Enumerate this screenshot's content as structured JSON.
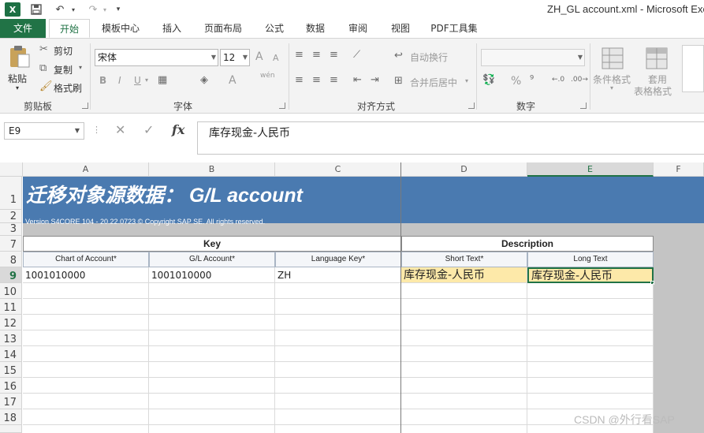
{
  "app": {
    "window_title": "ZH_GL account.xml - Microsoft Exc",
    "logo": "X"
  },
  "quick_access": {
    "save_icon": "save-icon",
    "undo_icon": "undo-icon",
    "redo_icon": "redo-icon",
    "customize_icon": "customize-icon"
  },
  "tabs": [
    {
      "label": "文件"
    },
    {
      "label": "开始"
    },
    {
      "label": "模板中心"
    },
    {
      "label": "插入"
    },
    {
      "label": "页面布局"
    },
    {
      "label": "公式"
    },
    {
      "label": "数据"
    },
    {
      "label": "审阅"
    },
    {
      "label": "视图"
    },
    {
      "label": "PDF工具集"
    }
  ],
  "ribbon": {
    "clipboard": {
      "paste": "粘贴",
      "cut": "剪切",
      "copy": "复制",
      "format_painter": "格式刷",
      "label": "剪贴板"
    },
    "font": {
      "name": "宋体",
      "size": "12",
      "bold": "B",
      "italic": "I",
      "underline": "U",
      "grow": "A",
      "shrink": "A",
      "font_color": "A",
      "phonetic": "wén",
      "label": "字体"
    },
    "alignment": {
      "wrap": "自动换行",
      "merge": "合并后居中",
      "label": "对齐方式"
    },
    "number": {
      "percent": "%",
      "label": "数字"
    },
    "styles": {
      "conditional": "条件格式",
      "table_format_1": "套用",
      "table_format_2": "表格格式"
    }
  },
  "formula_bar": {
    "name_box": "E9",
    "cancel": "✕",
    "enter": "✓",
    "fx": "fx",
    "formula": "库存现金-人民币"
  },
  "columns": [
    "A",
    "B",
    "C",
    "D",
    "E",
    "F"
  ],
  "rows": [
    "1",
    "2",
    "3",
    "7",
    "8",
    "9",
    "10",
    "11",
    "12",
    "13",
    "14",
    "15",
    "16",
    "17",
    "18"
  ],
  "sheet": {
    "banner_title": "迁移对象源数据：  G/L account",
    "banner_subtitle": "Version S4CORE 104  - 20.22.0723 © Copyright SAP SE. All rights reserved.",
    "group_key": "Key",
    "group_description": "Description",
    "field_headers": [
      "Chart of Account*",
      "G/L Account*",
      "Language Key*",
      "Short Text*",
      "Long Text"
    ],
    "data_row": [
      "1001010000",
      "1001010000",
      "ZH",
      "库存现金-人民币",
      "库存现金-人民币"
    ]
  },
  "watermark": "CSDN @外行看SAP",
  "colors": {
    "excel_green": "#217346",
    "banner_blue": "#4a7ab0",
    "highlight_cell": "#fde9a9"
  }
}
